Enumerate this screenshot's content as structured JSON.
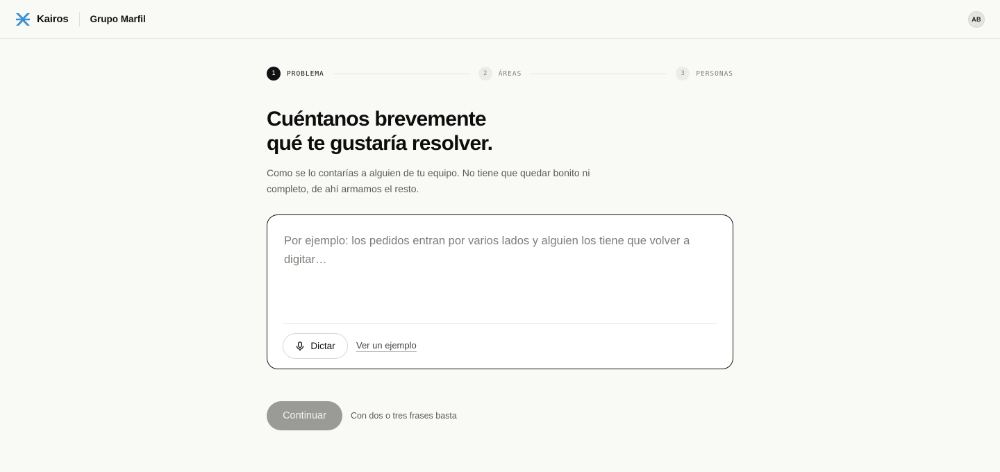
{
  "header": {
    "brand_name": "Kairos",
    "brand_icon": "kairos-logo-icon",
    "org_name": "Grupo Marfil",
    "avatar_initials": "AB"
  },
  "stepper": {
    "steps": [
      {
        "number": "1",
        "label": "PROBLEMA",
        "state": "active"
      },
      {
        "number": "2",
        "label": "ÁREAS",
        "state": "inactive"
      },
      {
        "number": "3",
        "label": "PERSONAS",
        "state": "inactive"
      }
    ]
  },
  "main": {
    "title_line1": "Cuéntanos brevemente",
    "title_line2": "qué te gustaría resolver.",
    "subtitle_line1": "Como se lo contarías a alguien de tu equipo. No tiene que quedar bonito ni",
    "subtitle_line2": "completo, de ahí armamos el resto.",
    "textarea": {
      "value": "",
      "placeholder": "Por ejemplo: los pedidos entran por varios lados y alguien los tiene que volver a digitar…"
    },
    "dictate_label": "Dictar",
    "dictate_icon": "microphone-icon",
    "example_link": "Ver un ejemplo"
  },
  "footer": {
    "continue_label": "Continuar",
    "hint": "Con dos o tres frases basta"
  },
  "colors": {
    "background": "#f9f9f6",
    "brand_accent": "#3b8fd0",
    "primary_text": "#111111",
    "disabled_button": "#9a9a97"
  }
}
